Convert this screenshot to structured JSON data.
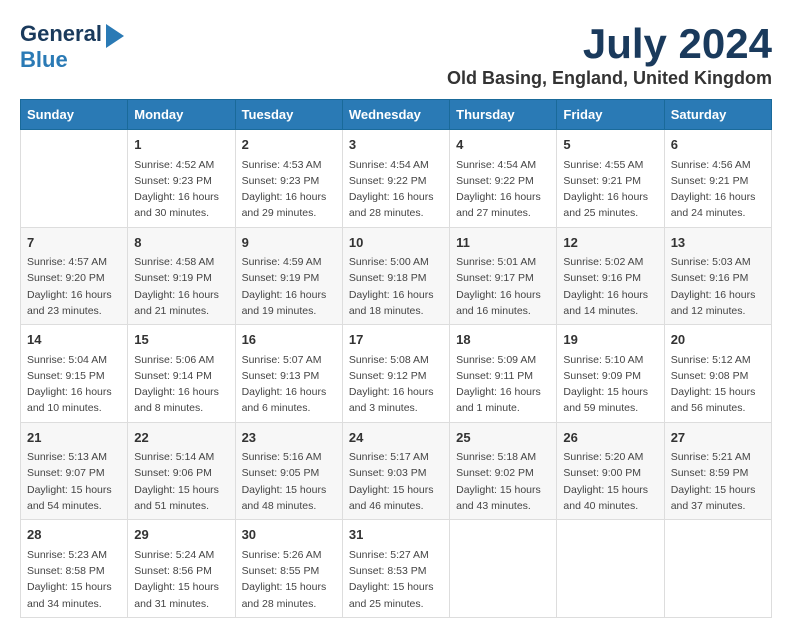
{
  "logo": {
    "line1": "General",
    "line2": "Blue"
  },
  "title": "July 2024",
  "subtitle": "Old Basing, England, United Kingdom",
  "days_of_week": [
    "Sunday",
    "Monday",
    "Tuesday",
    "Wednesday",
    "Thursday",
    "Friday",
    "Saturday"
  ],
  "weeks": [
    [
      {
        "num": "",
        "info": ""
      },
      {
        "num": "1",
        "info": "Sunrise: 4:52 AM\nSunset: 9:23 PM\nDaylight: 16 hours\nand 30 minutes."
      },
      {
        "num": "2",
        "info": "Sunrise: 4:53 AM\nSunset: 9:23 PM\nDaylight: 16 hours\nand 29 minutes."
      },
      {
        "num": "3",
        "info": "Sunrise: 4:54 AM\nSunset: 9:22 PM\nDaylight: 16 hours\nand 28 minutes."
      },
      {
        "num": "4",
        "info": "Sunrise: 4:54 AM\nSunset: 9:22 PM\nDaylight: 16 hours\nand 27 minutes."
      },
      {
        "num": "5",
        "info": "Sunrise: 4:55 AM\nSunset: 9:21 PM\nDaylight: 16 hours\nand 25 minutes."
      },
      {
        "num": "6",
        "info": "Sunrise: 4:56 AM\nSunset: 9:21 PM\nDaylight: 16 hours\nand 24 minutes."
      }
    ],
    [
      {
        "num": "7",
        "info": "Sunrise: 4:57 AM\nSunset: 9:20 PM\nDaylight: 16 hours\nand 23 minutes."
      },
      {
        "num": "8",
        "info": "Sunrise: 4:58 AM\nSunset: 9:19 PM\nDaylight: 16 hours\nand 21 minutes."
      },
      {
        "num": "9",
        "info": "Sunrise: 4:59 AM\nSunset: 9:19 PM\nDaylight: 16 hours\nand 19 minutes."
      },
      {
        "num": "10",
        "info": "Sunrise: 5:00 AM\nSunset: 9:18 PM\nDaylight: 16 hours\nand 18 minutes."
      },
      {
        "num": "11",
        "info": "Sunrise: 5:01 AM\nSunset: 9:17 PM\nDaylight: 16 hours\nand 16 minutes."
      },
      {
        "num": "12",
        "info": "Sunrise: 5:02 AM\nSunset: 9:16 PM\nDaylight: 16 hours\nand 14 minutes."
      },
      {
        "num": "13",
        "info": "Sunrise: 5:03 AM\nSunset: 9:16 PM\nDaylight: 16 hours\nand 12 minutes."
      }
    ],
    [
      {
        "num": "14",
        "info": "Sunrise: 5:04 AM\nSunset: 9:15 PM\nDaylight: 16 hours\nand 10 minutes."
      },
      {
        "num": "15",
        "info": "Sunrise: 5:06 AM\nSunset: 9:14 PM\nDaylight: 16 hours\nand 8 minutes."
      },
      {
        "num": "16",
        "info": "Sunrise: 5:07 AM\nSunset: 9:13 PM\nDaylight: 16 hours\nand 6 minutes."
      },
      {
        "num": "17",
        "info": "Sunrise: 5:08 AM\nSunset: 9:12 PM\nDaylight: 16 hours\nand 3 minutes."
      },
      {
        "num": "18",
        "info": "Sunrise: 5:09 AM\nSunset: 9:11 PM\nDaylight: 16 hours\nand 1 minute."
      },
      {
        "num": "19",
        "info": "Sunrise: 5:10 AM\nSunset: 9:09 PM\nDaylight: 15 hours\nand 59 minutes."
      },
      {
        "num": "20",
        "info": "Sunrise: 5:12 AM\nSunset: 9:08 PM\nDaylight: 15 hours\nand 56 minutes."
      }
    ],
    [
      {
        "num": "21",
        "info": "Sunrise: 5:13 AM\nSunset: 9:07 PM\nDaylight: 15 hours\nand 54 minutes."
      },
      {
        "num": "22",
        "info": "Sunrise: 5:14 AM\nSunset: 9:06 PM\nDaylight: 15 hours\nand 51 minutes."
      },
      {
        "num": "23",
        "info": "Sunrise: 5:16 AM\nSunset: 9:05 PM\nDaylight: 15 hours\nand 48 minutes."
      },
      {
        "num": "24",
        "info": "Sunrise: 5:17 AM\nSunset: 9:03 PM\nDaylight: 15 hours\nand 46 minutes."
      },
      {
        "num": "25",
        "info": "Sunrise: 5:18 AM\nSunset: 9:02 PM\nDaylight: 15 hours\nand 43 minutes."
      },
      {
        "num": "26",
        "info": "Sunrise: 5:20 AM\nSunset: 9:00 PM\nDaylight: 15 hours\nand 40 minutes."
      },
      {
        "num": "27",
        "info": "Sunrise: 5:21 AM\nSunset: 8:59 PM\nDaylight: 15 hours\nand 37 minutes."
      }
    ],
    [
      {
        "num": "28",
        "info": "Sunrise: 5:23 AM\nSunset: 8:58 PM\nDaylight: 15 hours\nand 34 minutes."
      },
      {
        "num": "29",
        "info": "Sunrise: 5:24 AM\nSunset: 8:56 PM\nDaylight: 15 hours\nand 31 minutes."
      },
      {
        "num": "30",
        "info": "Sunrise: 5:26 AM\nSunset: 8:55 PM\nDaylight: 15 hours\nand 28 minutes."
      },
      {
        "num": "31",
        "info": "Sunrise: 5:27 AM\nSunset: 8:53 PM\nDaylight: 15 hours\nand 25 minutes."
      },
      {
        "num": "",
        "info": ""
      },
      {
        "num": "",
        "info": ""
      },
      {
        "num": "",
        "info": ""
      }
    ]
  ]
}
